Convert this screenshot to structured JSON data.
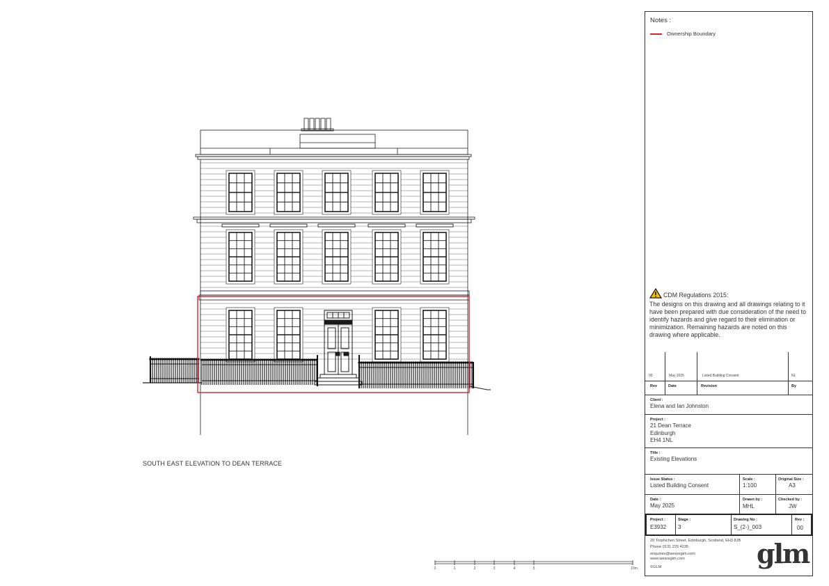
{
  "drawing": {
    "elevation_title": "SOUTH EAST ELEVATION TO DEAN TERRACE",
    "scale_bar": {
      "labels": [
        "0",
        "1",
        "2",
        "3",
        "4",
        "5",
        "10m"
      ]
    },
    "colors": {
      "line": "#1a1a1a",
      "ownership_boundary": "#d4232b"
    }
  },
  "title_block": {
    "notes_heading": "Notes :",
    "legend": {
      "label": "Ownership Boundary",
      "color": "#d4232b"
    },
    "cdm": {
      "title": "CDM Regulations 2015:",
      "text": "The designs on this drawing and all drawings relating to it have been prepared with due consideration of the need to identify hazards and give regard to their elimination or minimization. Remaining hazards are noted on this drawing where applicable."
    },
    "revision_row": {
      "rev": "00",
      "date": "May 2025",
      "revision": "Listed Building Consent",
      "by": "NL"
    },
    "revision_headers": {
      "rev": "Rev",
      "date": "Date",
      "revision": "Revision",
      "by": "By"
    },
    "client": {
      "label": "Client :",
      "value": "Elena and Ian Johnston"
    },
    "project": {
      "label": "Project :",
      "line1": "21 Dean Terrace",
      "line2": "Edinburgh",
      "line3": "EH4 1NL"
    },
    "title": {
      "label": "Title :",
      "value": "Existing Elevations"
    },
    "issue_status": {
      "label": "Issue Status :",
      "value": "Listed Building Consent"
    },
    "scale": {
      "label": "Scale :",
      "value": "1:100"
    },
    "original_size": {
      "label": "Original Size :",
      "value": "A3"
    },
    "date": {
      "label": "Date :",
      "value": "May 2025"
    },
    "drawn_by": {
      "label": "Drawn by :",
      "value": "MHL"
    },
    "checked_by": {
      "label": "Checked by :",
      "value": "JW"
    },
    "project_no": {
      "label": "Project :",
      "value": "E3932"
    },
    "stage": {
      "label": "Stage :",
      "value": "3"
    },
    "drawing_no": {
      "label": "Drawing No :",
      "value": "S_(2-)_003"
    },
    "rev": {
      "label": "Rev :",
      "value": "00"
    },
    "address": {
      "line1": "20 Torphichen Street, Edinburgh, Scotland, EH3 8JB",
      "line2": "Phone 0131 225 4235",
      "line3": "enquiries@wearegim.com",
      "line4": "www.wearegim.com",
      "line5": "©GLM"
    },
    "logo_text": "glm"
  }
}
